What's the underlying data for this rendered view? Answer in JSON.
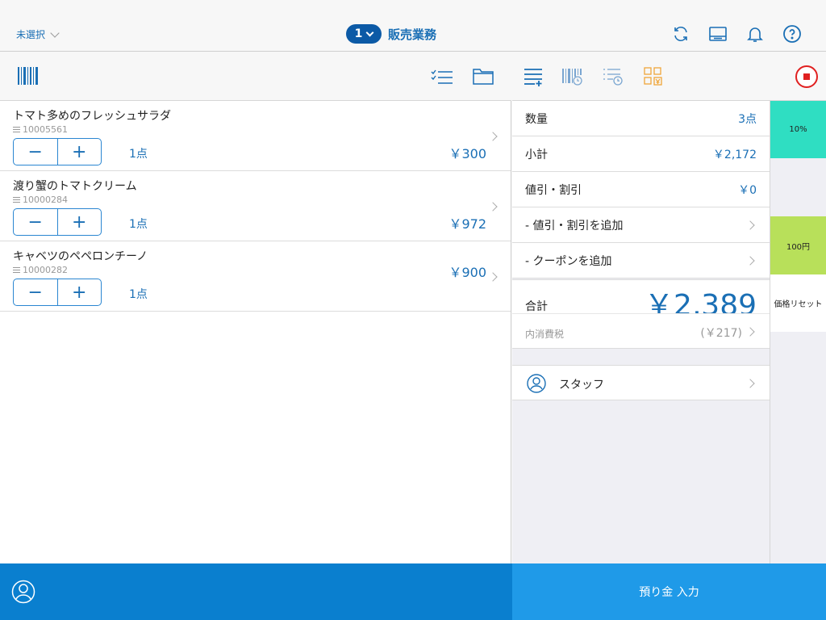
{
  "header": {
    "store_select": "未選択",
    "register_number": "1",
    "mode_title": "販売業務",
    "icons": [
      "sync-icon",
      "register-display-icon",
      "bell-icon",
      "help-icon"
    ]
  },
  "left_toolbar": {
    "icons": [
      "barcode-icon",
      "checklist-icon",
      "folder-icon"
    ]
  },
  "items": [
    {
      "name": "トマト多めのフレッシュサラダ",
      "code": "10005561",
      "qty": "1点",
      "price": "￥300"
    },
    {
      "name": "渡り蟹のトマトクリーム",
      "code": "10000284",
      "qty": "1点",
      "price": "￥972"
    },
    {
      "name": "キャベツのペペロンチーノ",
      "code": "10000282",
      "qty": "1点",
      "price": "￥900"
    }
  ],
  "stepper": {
    "minus": "−",
    "plus": "+"
  },
  "right_toolbar": {
    "icons": [
      "menu-add-icon",
      "barcode-history-icon",
      "list-clock-icon",
      "grid-yen-icon",
      "stop-icon"
    ],
    "accent_orange": "#f0a63a",
    "stop_red": "#e02020"
  },
  "summary": {
    "quantity_label": "数量",
    "quantity_value": "3点",
    "subtotal_label": "小計",
    "subtotal_value": "￥2,172",
    "discount_label": "値引・割引",
    "discount_value": "￥0",
    "add_discount_label": "- 値引・割引を追加",
    "add_coupon_label": "- クーポンを追加",
    "total_label": "合計",
    "total_value": "￥2,389",
    "tax_label": "内消費税",
    "tax_value": "(￥217)",
    "staff_label": "スタッフ"
  },
  "quick_buttons": [
    {
      "label": "10%",
      "color": "#2fdec2"
    },
    {
      "label": "100円",
      "color": "#b8e05a"
    },
    {
      "label": "価格リセット",
      "color": "#ffffff"
    }
  ],
  "footer": {
    "deposit_label": "預り金 入力",
    "left_color": "#0a7fcf",
    "right_color": "#1f9ae8"
  }
}
